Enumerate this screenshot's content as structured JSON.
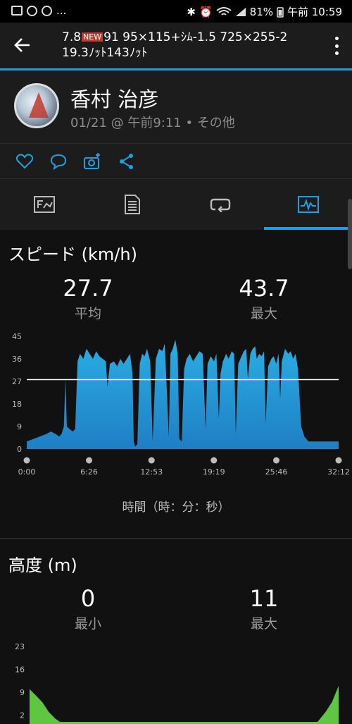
{
  "status_bar": {
    "left_icons": [
      "image-icon",
      "sync-icon",
      "sync-icon",
      "more-icon"
    ],
    "left_more": "...",
    "battery": "81%",
    "time": "午前 10:59",
    "icons": [
      "bluetooth-icon",
      "alarm-icon",
      "volte-icon",
      "wifi-icon",
      "signal-icon",
      "battery-icon"
    ]
  },
  "toolbar": {
    "title_line1_prefix": "7.8",
    "title_badge": "NEW",
    "title_line1_suffix": "91 95×115+ｼﾑ-1.5 725×255-2",
    "title_line2": "19.3ﾉｯﾄ143ﾉｯﾄ"
  },
  "profile": {
    "name": "香村 治彦",
    "meta": "01/21 @ 午前9:11 • その他"
  },
  "actions": [
    "like-icon",
    "comment-icon",
    "add-photo-icon",
    "share-icon"
  ],
  "tabs": [
    {
      "icon": "overview-icon",
      "active": false
    },
    {
      "icon": "details-icon",
      "active": false
    },
    {
      "icon": "laps-icon",
      "active": false
    },
    {
      "icon": "charts-icon",
      "active": true
    }
  ],
  "speed": {
    "title": "スピード (km/h)",
    "avg_value": "27.7",
    "avg_label": "平均",
    "max_value": "43.7",
    "max_label": "最大",
    "x_axis_label": "時間（時：分：秒）"
  },
  "elevation": {
    "title": "高度 (m)",
    "min_value": "0",
    "min_label": "最小",
    "max_value": "11",
    "max_label": "最大"
  },
  "colors": {
    "accent": "#1ba1e2",
    "speed_fill_top": "#2aaee4",
    "speed_fill_bottom": "#1f7fc4",
    "elevation_fill": "#5ec641"
  },
  "chart_data": [
    {
      "type": "area",
      "y_ticks": [
        0,
        9,
        18,
        27,
        36,
        45
      ],
      "ylim": [
        0,
        45
      ],
      "x_ticks": [
        "0:00",
        "6:26",
        "12:53",
        "19:19",
        "25:46",
        "32:12"
      ],
      "xlim_seconds": [
        0,
        1932
      ],
      "grid": false,
      "average_line": 27.7,
      "points": [
        [
          0,
          3
        ],
        [
          40,
          4
        ],
        [
          80,
          5
        ],
        [
          120,
          6
        ],
        [
          150,
          7
        ],
        [
          180,
          6
        ],
        [
          200,
          5
        ],
        [
          215,
          6
        ],
        [
          230,
          9
        ],
        [
          240,
          28
        ],
        [
          248,
          9
        ],
        [
          265,
          8
        ],
        [
          285,
          7
        ],
        [
          300,
          8
        ],
        [
          315,
          35
        ],
        [
          330,
          38
        ],
        [
          350,
          36
        ],
        [
          370,
          40
        ],
        [
          390,
          38
        ],
        [
          410,
          36
        ],
        [
          430,
          39
        ],
        [
          450,
          37
        ],
        [
          470,
          36
        ],
        [
          490,
          35
        ],
        [
          500,
          25
        ],
        [
          515,
          34
        ],
        [
          540,
          35
        ],
        [
          560,
          33
        ],
        [
          580,
          36
        ],
        [
          600,
          34
        ],
        [
          620,
          36
        ],
        [
          640,
          38
        ],
        [
          655,
          30
        ],
        [
          663,
          3
        ],
        [
          672,
          1
        ],
        [
          685,
          2
        ],
        [
          700,
          34
        ],
        [
          715,
          38
        ],
        [
          730,
          37
        ],
        [
          745,
          40
        ],
        [
          765,
          35
        ],
        [
          780,
          3
        ],
        [
          800,
          36
        ],
        [
          820,
          40
        ],
        [
          840,
          39
        ],
        [
          855,
          42
        ],
        [
          870,
          20
        ],
        [
          880,
          5
        ],
        [
          890,
          38
        ],
        [
          905,
          40
        ],
        [
          920,
          43.7
        ],
        [
          935,
          38
        ],
        [
          945,
          4
        ],
        [
          960,
          3
        ],
        [
          975,
          32
        ],
        [
          990,
          36
        ],
        [
          1010,
          38
        ],
        [
          1030,
          35
        ],
        [
          1050,
          37
        ],
        [
          1070,
          39
        ],
        [
          1090,
          38
        ],
        [
          1108,
          8
        ],
        [
          1120,
          34
        ],
        [
          1140,
          37
        ],
        [
          1160,
          35
        ],
        [
          1175,
          38
        ],
        [
          1190,
          12
        ],
        [
          1200,
          30
        ],
        [
          1215,
          35
        ],
        [
          1235,
          38
        ],
        [
          1250,
          36
        ],
        [
          1270,
          39
        ],
        [
          1285,
          38
        ],
        [
          1295,
          6
        ],
        [
          1310,
          34
        ],
        [
          1330,
          37
        ],
        [
          1345,
          39
        ],
        [
          1360,
          40
        ],
        [
          1370,
          28
        ],
        [
          1385,
          38
        ],
        [
          1400,
          40
        ],
        [
          1415,
          41
        ],
        [
          1425,
          36
        ],
        [
          1440,
          38
        ],
        [
          1455,
          37
        ],
        [
          1470,
          39
        ],
        [
          1480,
          10
        ],
        [
          1495,
          33
        ],
        [
          1515,
          36
        ],
        [
          1530,
          37
        ],
        [
          1545,
          34
        ],
        [
          1560,
          38
        ],
        [
          1570,
          20
        ],
        [
          1580,
          35
        ],
        [
          1600,
          40
        ],
        [
          1620,
          38
        ],
        [
          1635,
          39
        ],
        [
          1650,
          36
        ],
        [
          1665,
          38
        ],
        [
          1680,
          32
        ],
        [
          1700,
          9
        ],
        [
          1720,
          5
        ],
        [
          1745,
          3
        ],
        [
          1770,
          3
        ],
        [
          1932,
          3
        ]
      ]
    },
    {
      "type": "area",
      "y_ticks": [
        2,
        9,
        16,
        23
      ],
      "ylim": [
        0,
        23
      ],
      "xlim_seconds": [
        0,
        1932
      ],
      "grid": false,
      "points": [
        [
          0,
          10
        ],
        [
          40,
          8
        ],
        [
          80,
          6
        ],
        [
          120,
          3
        ],
        [
          160,
          1
        ],
        [
          190,
          0
        ],
        [
          1800,
          0
        ],
        [
          1850,
          3
        ],
        [
          1890,
          6
        ],
        [
          1932,
          11
        ]
      ]
    }
  ]
}
